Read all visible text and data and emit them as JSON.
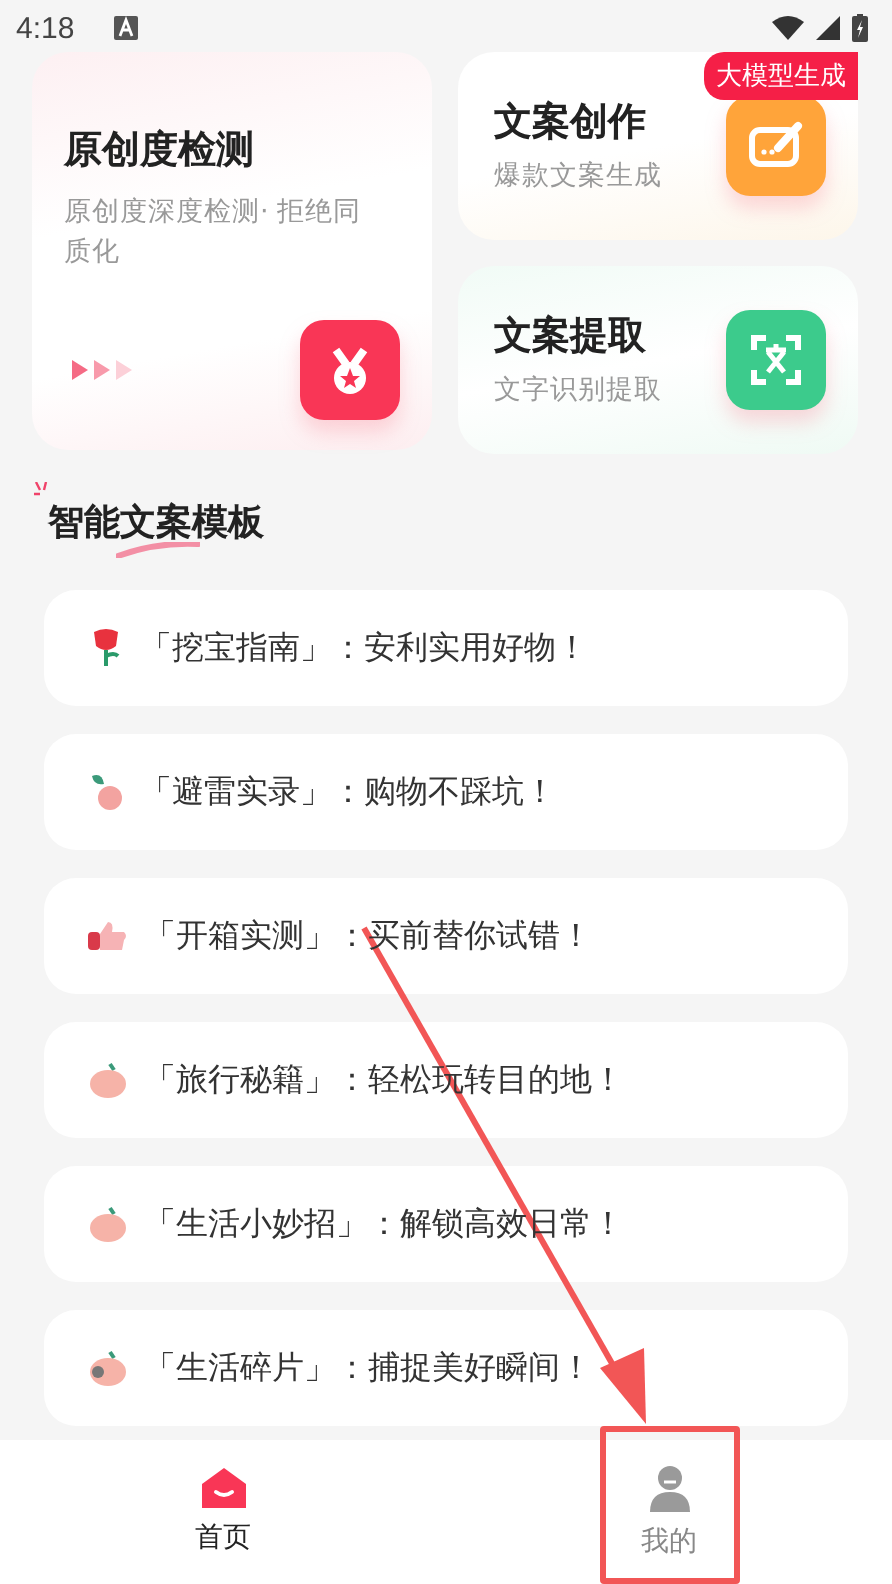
{
  "status_bar": {
    "time": "4:18"
  },
  "features": [
    {
      "kind": "large",
      "title": "原创度检测",
      "subtitle": "原创度深度检测· 拒绝同质化",
      "color": "#f93656"
    },
    {
      "kind": "small",
      "title": "文案创作",
      "subtitle": "爆款文案生成",
      "color": "#ffa43a",
      "badge": "大模型生成"
    },
    {
      "kind": "small",
      "title": "文案提取",
      "subtitle": "文字识别提取",
      "color": "#3ccb8c"
    }
  ],
  "section_title": "智能文案模板",
  "templates": [
    {
      "label": "「挖宝指南」：安利实用好物！"
    },
    {
      "label": "「避雷实录」：购物不踩坑！"
    },
    {
      "label": "「开箱实测」：买前替你试错！"
    },
    {
      "label": "「旅行秘籍」：轻松玩转目的地！"
    },
    {
      "label": "「生活小妙招」：解锁高效日常！"
    },
    {
      "label": "「生活碎片」：捕捉美好瞬间！"
    }
  ],
  "nav": [
    {
      "label": "首页",
      "selected": true
    },
    {
      "label": "我的",
      "selected": false
    }
  ]
}
